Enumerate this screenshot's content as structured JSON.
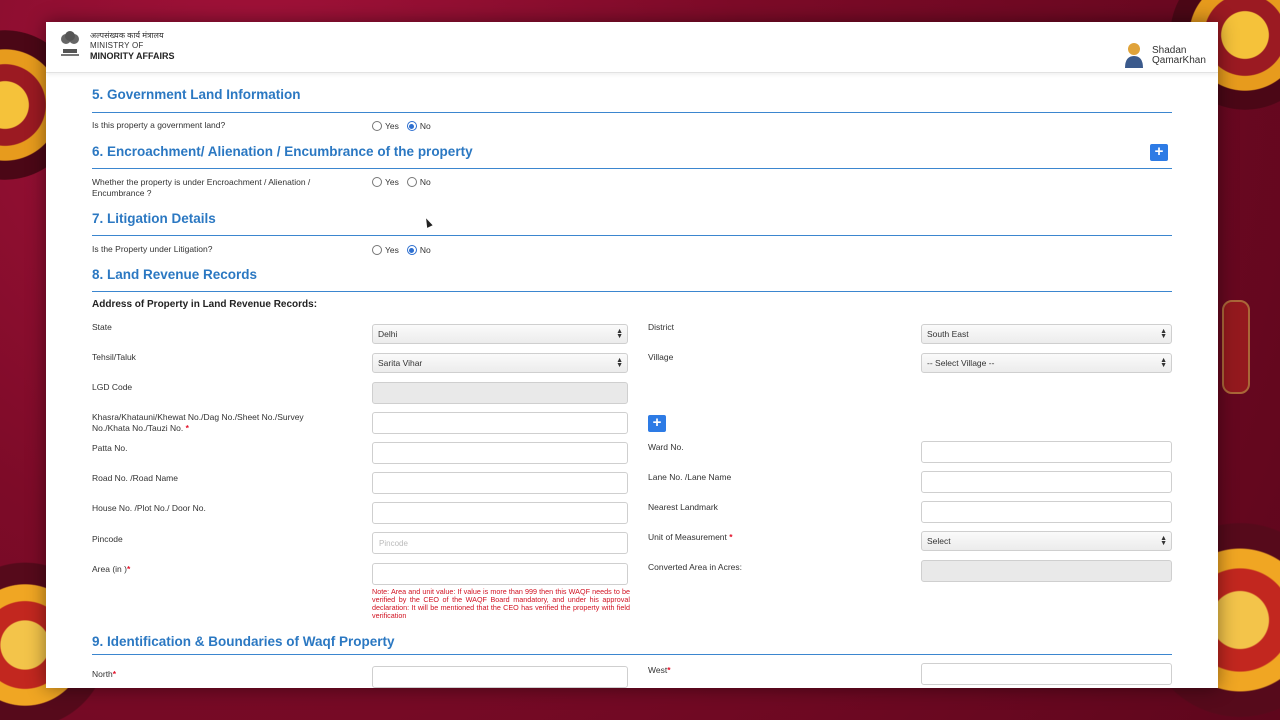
{
  "header": {
    "ministry_hindi": "अल्पसंख्यक कार्य मंत्रालय",
    "ministry_line1": "MINISTRY OF",
    "ministry_line2": "MINORITY AFFAIRS",
    "user_first": "Shadan",
    "user_last": "QamarKhan"
  },
  "sections": {
    "s5": {
      "title": "5. Government Land Information",
      "question": "Is this property a government land?",
      "yes": "Yes",
      "no": "No",
      "selected": "No"
    },
    "s6": {
      "title": "6. Encroachment/ Alienation / Encumbrance of the property",
      "question_l1": "Whether the property is under Encroachment / Alienation /",
      "question_l2": "Encumbrance ?",
      "yes": "Yes",
      "no": "No",
      "selected": ""
    },
    "s7": {
      "title": "7. Litigation Details",
      "question": "Is the Property under Litigation?",
      "yes": "Yes",
      "no": "No",
      "selected": "No"
    },
    "s8": {
      "title": "8. Land Revenue Records",
      "subheading": "Address of Property in Land Revenue Records:",
      "state_label": "State",
      "state_value": "Delhi",
      "district_label": "District",
      "district_value": "South East",
      "tehsil_label": "Tehsil/Taluk",
      "tehsil_value": "Sarita Vihar",
      "village_label": "Village",
      "village_value": "-- Select Village --",
      "lgd_label": "LGD Code",
      "khasra_label_l1": "Khasra/Khatauni/Khewat No./Dag No./Sheet No./Survey",
      "khasra_label_l2": "No./Khata No./Tauzi No.",
      "patta_label": "Patta No.",
      "ward_label": "Ward No.",
      "road_label": "Road No. /Road Name",
      "lane_label": "Lane No. /Lane Name",
      "house_label": "House No. /Plot No./ Door No.",
      "landmark_label": "Nearest Landmark",
      "pincode_label": "Pincode",
      "pincode_placeholder": "Pincode",
      "uom_label": "Unit of Measurement",
      "uom_value": "Select",
      "area_label": "Area (in  )",
      "converted_label": "Converted Area in Acres:",
      "note": "Note: Area and unit value: If value is more than 999 then this WAQF needs to be verified by the CEO of the WAQF Board mandatory, and under his approval declaration: It will be mentioned that the CEO has verified the property with field verification"
    },
    "s9": {
      "title": "9. Identification & Boundaries of Waqf Property",
      "north_label": "North",
      "west_label": "West"
    }
  },
  "required_mark": "*",
  "plus_symbol": "+",
  "colors": {
    "accent": "#2b78c2",
    "button": "#2d7be5",
    "required": "#e3122a",
    "background": "#8a0f2e"
  }
}
